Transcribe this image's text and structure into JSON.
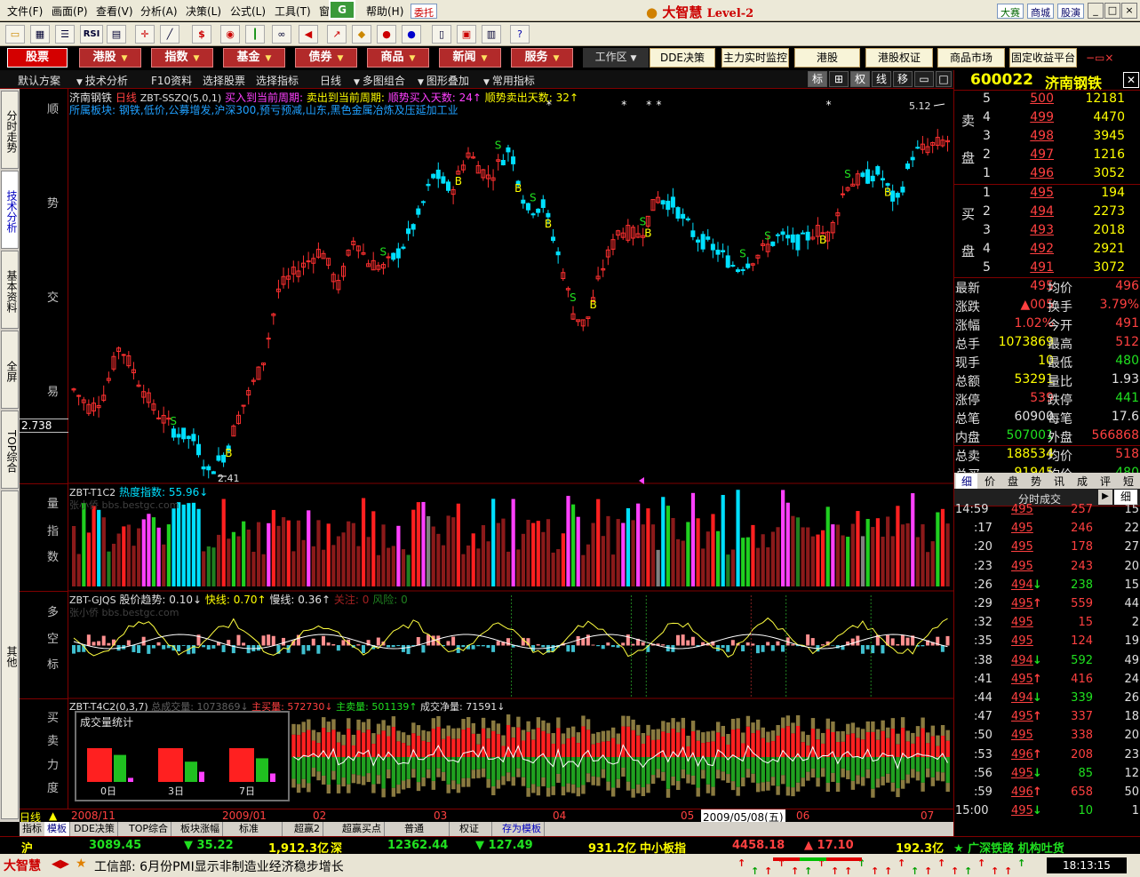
{
  "menu": [
    "文件(F)",
    "画面(P)",
    "查看(V)",
    "分析(A)",
    "决策(L)",
    "公式(L)",
    "工具(T)",
    "窗",
    "帮助(H)"
  ],
  "top_badge": "委托",
  "brand": {
    "name": "大智慧",
    "level": "Level-2"
  },
  "top_right": [
    "大赛",
    "商城",
    "股演"
  ],
  "toolbar_icons": [
    "open-icon",
    "chart-icon",
    "list-icon",
    "rsi-icon",
    "grid-icon",
    "crosshair-icon",
    "ruler-icon",
    "dollar-icon",
    "candle-icon",
    "bars-icon",
    "binoculars-icon",
    "megaphone-icon",
    "arrow-icon",
    "diamond-icon",
    "red-disc-icon",
    "blue-disc-icon",
    "document-icon",
    "window-icon",
    "books-icon",
    "help-icon"
  ],
  "rsi_label": "RSI",
  "nav": {
    "primary": [
      "股票",
      "港股",
      "指数",
      "基金",
      "债券",
      "商品",
      "新闻",
      "服务"
    ],
    "workspace": "工作区",
    "secondary": [
      "DDE决策",
      "主力实时监控",
      "港股",
      "港股权证",
      "商品市场",
      "固定收益平台"
    ]
  },
  "subbar": {
    "items": [
      "默认方案",
      "技术分析",
      "F10资料",
      "选择股票",
      "选择指标",
      "日线",
      "多图组合",
      "图形叠加",
      "常用指标"
    ],
    "tools": [
      "标",
      "⊞",
      "权",
      "线",
      "移",
      "▭",
      "□"
    ]
  },
  "left_tabs": [
    "分时走势",
    "技术分析",
    "基本资料",
    "全屏",
    "TOP综合",
    "其他"
  ],
  "labels": {
    "main": [
      "顺",
      "势",
      "交",
      "易"
    ],
    "price_marker": "2.738",
    "vol": [
      "量",
      "指",
      "数"
    ],
    "trend": [
      "多",
      "空",
      "标"
    ],
    "power": [
      "买",
      "卖",
      "力",
      "度"
    ]
  },
  "chart_head": {
    "stock": "济南钢铁",
    "period": "日线",
    "formula": "ZBT-SSZQ(5,0,1)",
    "buy_days": "买入到当前周期:",
    "sell_days": "卖出到当前周期:",
    "trend_buy": "顺势买入天数:",
    "trend_buy_val": "24↑",
    "trend_sell": "顺势卖出天数:",
    "trend_sell_val": "32↑",
    "sector_label": "所属板块:",
    "sectors": "钢铁,低价,公募增发,沪深300,预亏预减,山东,黑色金属冶炼及压延加工业",
    "high_label": "5.12",
    "low_label": "2.41"
  },
  "vol_head": {
    "formula": "ZBT-T1C2",
    "name": "热度指数:",
    "value": "55.96↓",
    "watermark": "张小侨 bbs.bestgc.com"
  },
  "trend_head": {
    "formula": "ZBT-GJQS",
    "trend": "股价趋势:",
    "trend_val": "0.10↓",
    "fast": "快线:",
    "fast_val": "0.70↑",
    "slow": "慢线:",
    "slow_val": "0.36↑",
    "warn": "关注:",
    "warn_val": "0",
    "risk": "风险:",
    "risk_val": "0",
    "watermark": "张小侨 bbs.bestgc.com"
  },
  "power_head": {
    "formula": "ZBT-T4C2(0,3,7)",
    "total": "总成交量:",
    "total_val": "1073869↓",
    "main_buy": "主买量:",
    "main_buy_val": "572730↓",
    "main_sell": "主卖量:",
    "main_sell_val": "501139↑",
    "net": "成交净量:",
    "net_val": "71591↓"
  },
  "stat_panel": {
    "title": "成交量统计",
    "groups": [
      {
        "label": "0日",
        "red": 1.0,
        "green": 0.8,
        "mag": 0.12
      },
      {
        "label": "3日",
        "red": 1.0,
        "green": 0.6,
        "mag": 0.3
      },
      {
        "label": "7日",
        "red": 1.0,
        "green": 0.7,
        "mag": 0.25
      }
    ]
  },
  "dates": {
    "period": "日线",
    "d1": "2008/11",
    "d2": "2009/01",
    "d3": "02",
    "d4": "03",
    "d5": "04",
    "d6": "05",
    "cursor": "2009/05/08(五)",
    "d7": "06",
    "d8": "07"
  },
  "bottom_tabs": [
    "指标",
    "模板",
    "DDE决策",
    "TOP综合",
    "板块涨幅",
    "标准",
    "超赢2",
    "超赢买点",
    "普通",
    "权证",
    "存为模板"
  ],
  "ticker": {
    "sh_label": "沪",
    "sh": "3089.45",
    "sh_chg": "▼ 35.22",
    "sh_amt": "1,912.3亿",
    "sz_label": "深",
    "sz": "12362.44",
    "sz_chg": "▼ 127.49",
    "sz_amt": "931.2亿",
    "mid_label": "中小板指",
    "mid": "4458.18",
    "mid_chg": "▲ 17.10",
    "mid_amt": "192.3亿",
    "news": "★ 广深铁路 机构吐货"
  },
  "newsbar": {
    "brand": "大智慧",
    "text": "工信部: 6月份PMI显示非制造业经济稳步增长",
    "time": "18:13:15"
  },
  "quote": {
    "code": "600022",
    "name": "济南钢铁",
    "sell_label": [
      "卖",
      "盘"
    ],
    "buy_label": [
      "买",
      "盘"
    ],
    "asks": [
      {
        "lvl": "5",
        "price": "500",
        "vol": "12181"
      },
      {
        "lvl": "4",
        "price": "499",
        "vol": "4470"
      },
      {
        "lvl": "3",
        "price": "498",
        "vol": "3945"
      },
      {
        "lvl": "2",
        "price": "497",
        "vol": "1216"
      },
      {
        "lvl": "1",
        "price": "496",
        "vol": "3052"
      }
    ],
    "bids": [
      {
        "lvl": "1",
        "price": "495",
        "vol": "194"
      },
      {
        "lvl": "2",
        "price": "494",
        "vol": "2273"
      },
      {
        "lvl": "3",
        "price": "493",
        "vol": "2018"
      },
      {
        "lvl": "4",
        "price": "492",
        "vol": "2921"
      },
      {
        "lvl": "5",
        "price": "491",
        "vol": "3072"
      }
    ],
    "stats": [
      [
        "最新",
        "495",
        "均价",
        "496"
      ],
      [
        "涨跌",
        "▲005",
        "换手",
        "3.79%"
      ],
      [
        "涨幅",
        "1.02%",
        "今开",
        "491"
      ],
      [
        "总手",
        "1073869",
        "最高",
        "512"
      ],
      [
        "现手",
        "10",
        "最低",
        "480"
      ],
      [
        "总额",
        "53291",
        "量比",
        "1.93"
      ],
      [
        "涨停",
        "539",
        "跌停",
        "441"
      ],
      [
        "总笔",
        "60900",
        "每笔",
        "17.6"
      ],
      [
        "内盘",
        "507001",
        "外盘",
        "566868"
      ],
      [
        "总卖",
        "188534",
        "均价",
        "518"
      ],
      [
        "总买",
        "91945",
        "均价",
        "480"
      ]
    ],
    "tabs": [
      "细",
      "价",
      "盘",
      "势",
      "讯",
      "成",
      "评",
      "短"
    ],
    "tick_header": "分时成交",
    "tick_btn": "细",
    "ticks": [
      [
        "14:59",
        "495",
        "",
        "257",
        "15"
      ],
      [
        ":17",
        "495",
        "",
        "246",
        "22"
      ],
      [
        ":20",
        "495",
        "",
        "178",
        "27"
      ],
      [
        ":23",
        "495",
        "",
        "243",
        "20"
      ],
      [
        ":26",
        "494",
        "↓",
        "238",
        "15"
      ],
      [
        ":29",
        "495",
        "↑",
        "559",
        "44"
      ],
      [
        ":32",
        "495",
        "",
        "15",
        "2"
      ],
      [
        ":35",
        "495",
        "",
        "124",
        "19"
      ],
      [
        ":38",
        "494",
        "↓",
        "592",
        "49"
      ],
      [
        ":41",
        "495",
        "↑",
        "416",
        "24"
      ],
      [
        ":44",
        "494",
        "↓",
        "339",
        "26"
      ],
      [
        ":47",
        "495",
        "↑",
        "337",
        "18"
      ],
      [
        ":50",
        "495",
        "",
        "338",
        "20"
      ],
      [
        ":53",
        "496",
        "↑",
        "208",
        "23"
      ],
      [
        ":56",
        "495",
        "↓",
        "85",
        "12"
      ],
      [
        ":59",
        "496",
        "↑",
        "658",
        "50"
      ],
      [
        "15:00",
        "495",
        "↓",
        "10",
        "1"
      ]
    ]
  },
  "colors": {
    "up": "#ff3030",
    "down": "#00d8ff",
    "accent": "#ffff00",
    "grid": "#800000"
  }
}
